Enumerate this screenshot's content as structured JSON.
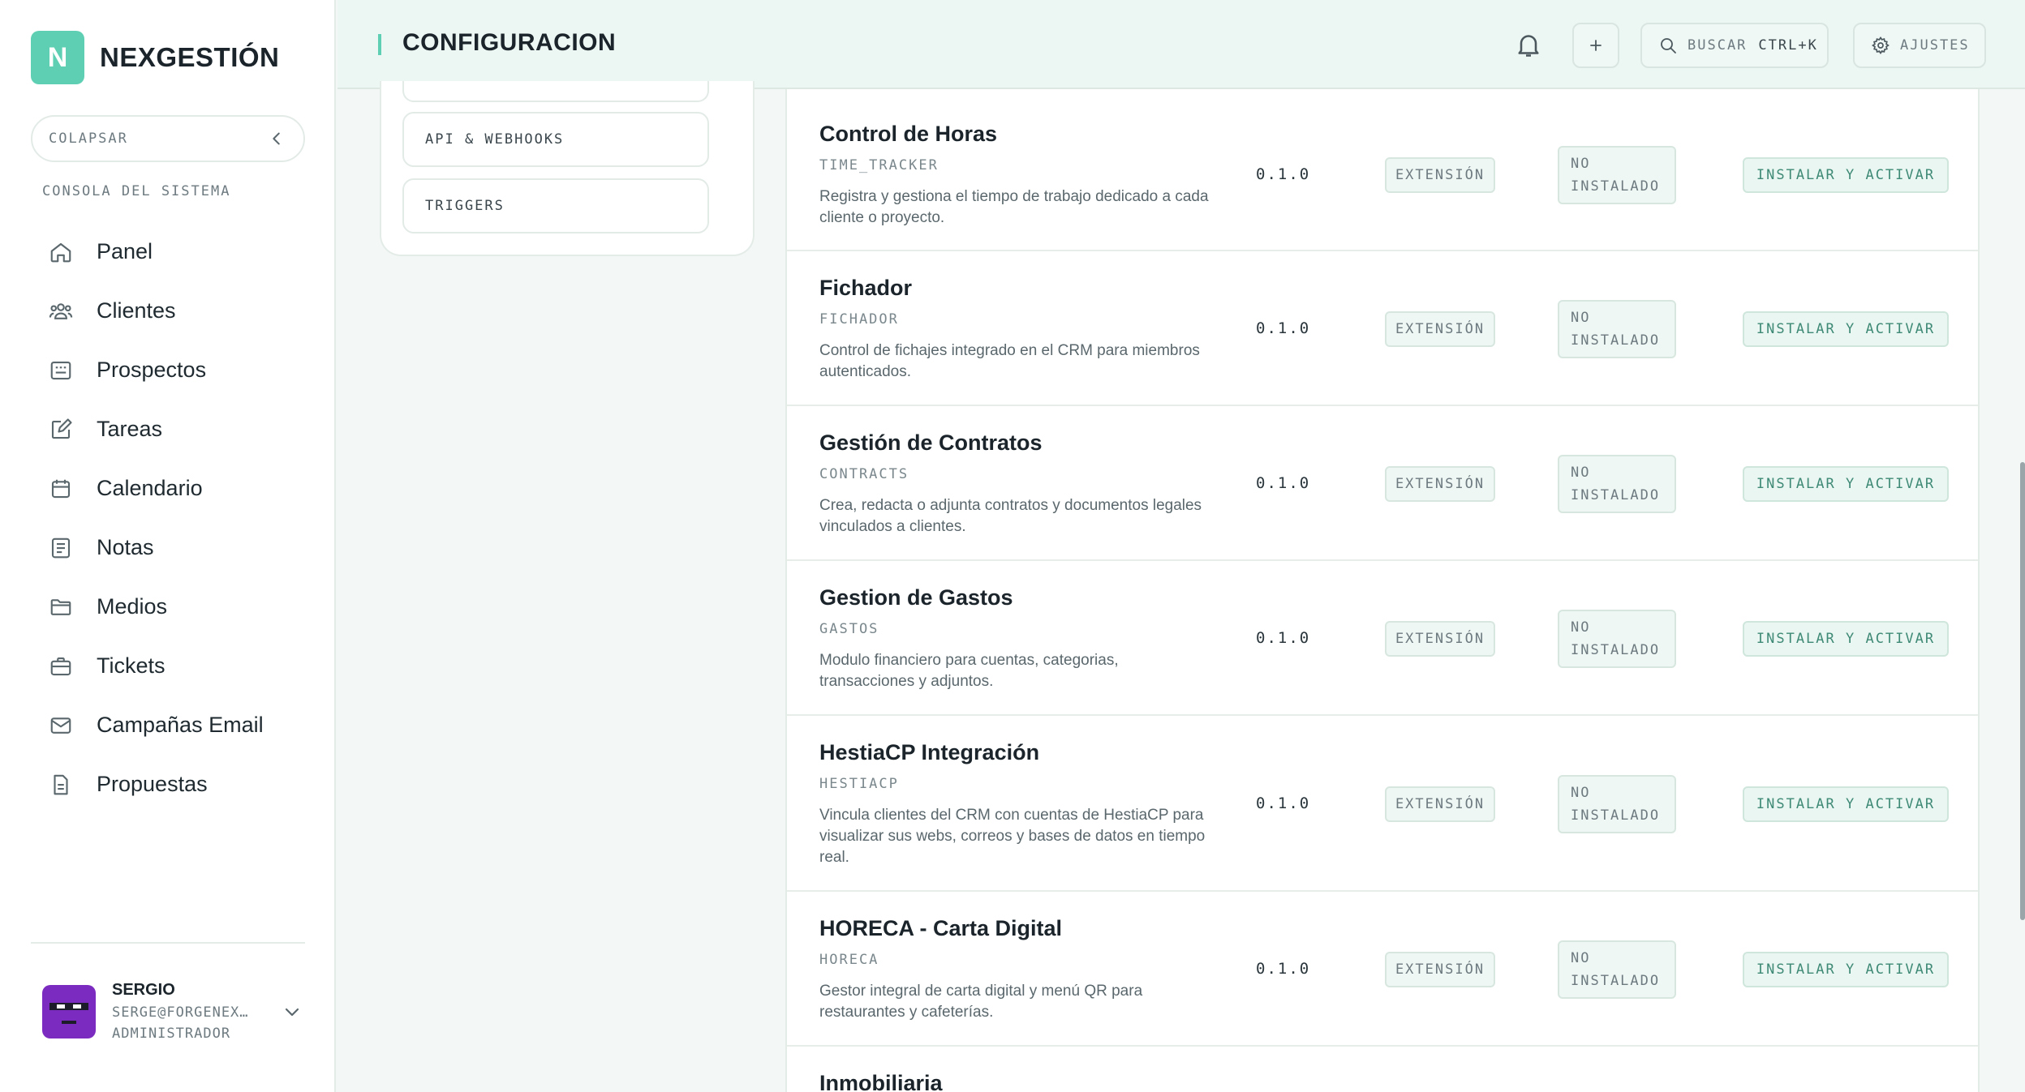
{
  "sidebar": {
    "brand_initial": "N",
    "brand_name": "NEXGESTIÓN",
    "collapse_label": "COLAPSAR",
    "section_label": "CONSOLA DEL SISTEMA",
    "items": [
      {
        "label": "Panel",
        "icon": "home-icon"
      },
      {
        "label": "Clientes",
        "icon": "users-icon"
      },
      {
        "label": "Prospectos",
        "icon": "id-card-icon"
      },
      {
        "label": "Tareas",
        "icon": "edit-icon"
      },
      {
        "label": "Calendario",
        "icon": "calendar-icon"
      },
      {
        "label": "Notas",
        "icon": "notes-icon"
      },
      {
        "label": "Medios",
        "icon": "folder-icon"
      },
      {
        "label": "Tickets",
        "icon": "briefcase-icon"
      },
      {
        "label": "Campañas Email",
        "icon": "mail-icon"
      },
      {
        "label": "Propuestas",
        "icon": "document-icon"
      }
    ],
    "user": {
      "name": "SERGIO",
      "email": "SERGE@FORGENEX…",
      "role": "ADMINISTRADOR"
    }
  },
  "header": {
    "title": "CONFIGURACION",
    "search_label": "BUSCAR",
    "search_shortcut": "CTRL+K",
    "settings_label": "AJUSTES"
  },
  "submenu": {
    "items": [
      "API & WEBHOOKS",
      "TRIGGERS"
    ]
  },
  "modules": [
    {
      "name": "Control de Horas",
      "slug": "TIME_TRACKER",
      "desc": "Registra y gestiona el tiempo de trabajo dedicado a cada cliente o proyecto.",
      "version": "0.1.0",
      "type": "EXTENSIÓN",
      "status_1": "NO",
      "status_2": "INSTALADO",
      "action": "INSTALAR Y ACTIVAR"
    },
    {
      "name": "Fichador",
      "slug": "FICHADOR",
      "desc": "Control de fichajes integrado en el CRM para miembros autenticados.",
      "version": "0.1.0",
      "type": "EXTENSIÓN",
      "status_1": "NO",
      "status_2": "INSTALADO",
      "action": "INSTALAR Y ACTIVAR"
    },
    {
      "name": "Gestión de Contratos",
      "slug": "CONTRACTS",
      "desc": "Crea, redacta o adjunta contratos y documentos legales vinculados a clientes.",
      "version": "0.1.0",
      "type": "EXTENSIÓN",
      "status_1": "NO",
      "status_2": "INSTALADO",
      "action": "INSTALAR Y ACTIVAR"
    },
    {
      "name": "Gestion de Gastos",
      "slug": "GASTOS",
      "desc": "Modulo financiero para cuentas, categorias, transacciones y adjuntos.",
      "version": "0.1.0",
      "type": "EXTENSIÓN",
      "status_1": "NO",
      "status_2": "INSTALADO",
      "action": "INSTALAR Y ACTIVAR"
    },
    {
      "name": "HestiaCP Integración",
      "slug": "HESTIACP",
      "desc": "Vincula clientes del CRM con cuentas de HestiaCP para visualizar sus webs, correos y bases de datos en tiempo real.",
      "version": "0.1.0",
      "type": "EXTENSIÓN",
      "status_1": "NO",
      "status_2": "INSTALADO",
      "action": "INSTALAR Y ACTIVAR"
    },
    {
      "name": "HORECA - Carta Digital",
      "slug": "HORECA",
      "desc": "Gestor integral de carta digital y menú QR para restaurantes y cafeterías.",
      "version": "0.1.0",
      "type": "EXTENSIÓN",
      "status_1": "NO",
      "status_2": "INSTALADO",
      "action": "INSTALAR Y ACTIVAR"
    },
    {
      "name": "Inmobiliaria"
    }
  ]
}
